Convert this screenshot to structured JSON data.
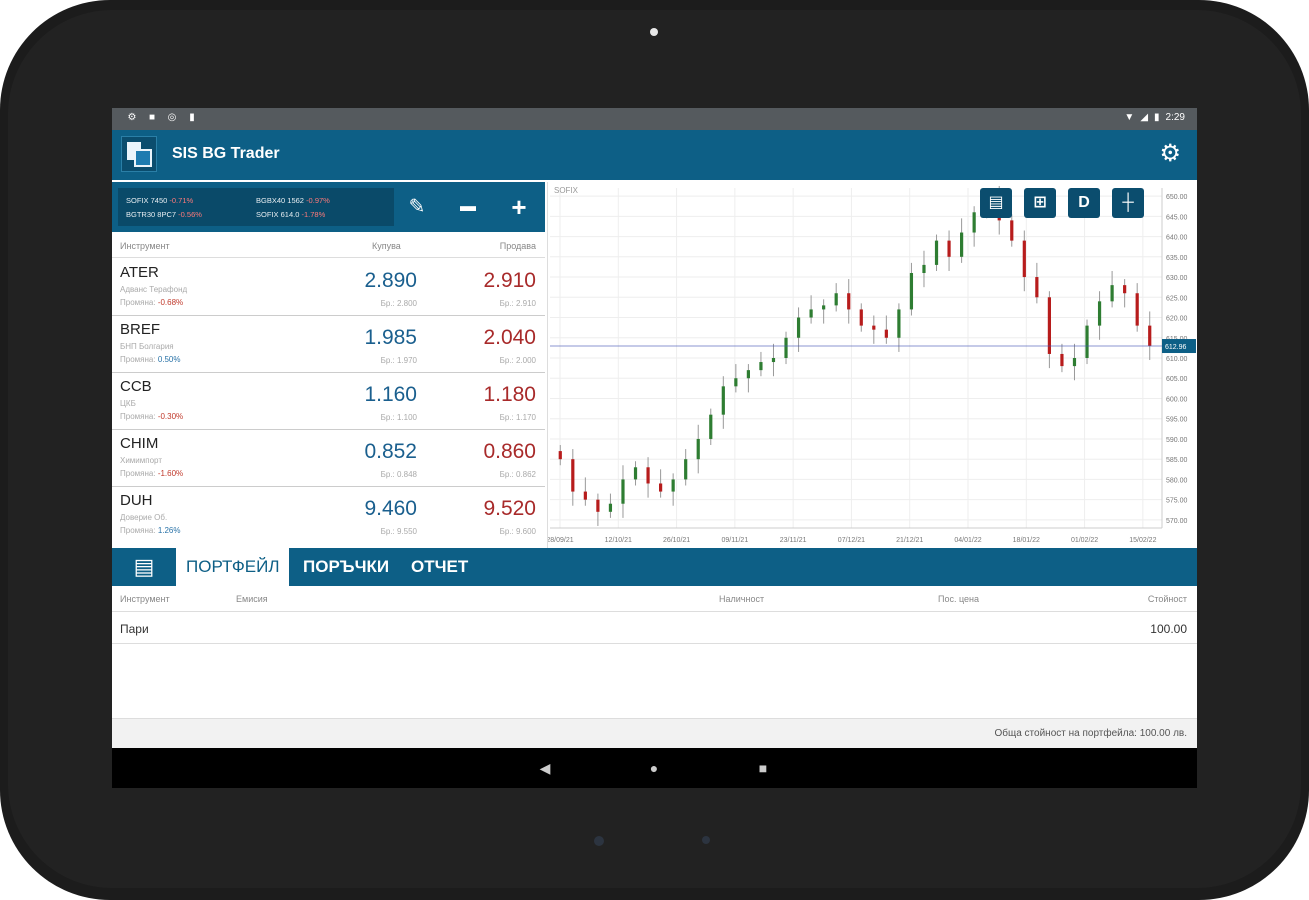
{
  "app": {
    "title": "SIS BG Trader"
  },
  "status": {
    "time": "2:29"
  },
  "ticker": [
    {
      "symbol": "SOFIX",
      "value": "7450",
      "change": "-0.71%"
    },
    {
      "symbol": "BGBX40",
      "value": "1562",
      "change": "-0.97%"
    },
    {
      "symbol": "BGTR30",
      "value": "8PC7",
      "change": "-0.56%"
    },
    {
      "symbol": "SOFIX",
      "value": "614.0",
      "change": "-1.78%"
    }
  ],
  "list": {
    "headers": {
      "instrument": "Инструмент",
      "buy": "Купува",
      "sell": "Продава"
    },
    "rows": [
      {
        "symbol": "ATER",
        "name": "Адванс Терафонд",
        "change_label": "Промяна:",
        "change": "-0.68%",
        "buy": "2.890",
        "sell": "2.910",
        "vol_buy": "Бр.: 2.800",
        "vol_sell": "Бр.: 2.910"
      },
      {
        "symbol": "BREF",
        "name": "БНП Болгария",
        "change_label": "Промяна:",
        "change": "0.50%",
        "buy": "1.985",
        "sell": "2.040",
        "vol_buy": "Бр.: 1.970",
        "vol_sell": "Бр.: 2.000"
      },
      {
        "symbol": "CCB",
        "name": "ЦКБ",
        "change_label": "Промяна:",
        "change": "-0.30%",
        "buy": "1.160",
        "sell": "1.180",
        "vol_buy": "Бр.: 1.100",
        "vol_sell": "Бр.: 1.170"
      },
      {
        "symbol": "CHIM",
        "name": "Химимпорт",
        "change_label": "Промяна:",
        "change": "-1.60%",
        "buy": "0.852",
        "sell": "0.860",
        "vol_buy": "Бр.: 0.848",
        "vol_sell": "Бр.: 0.862"
      },
      {
        "symbol": "DUH",
        "name": "Доверие Об.",
        "change_label": "Промяна:",
        "change": "1.26%",
        "buy": "9.460",
        "sell": "9.520",
        "vol_buy": "Бр.: 9.550",
        "vol_sell": "Бр.: 9.600"
      }
    ]
  },
  "chart": {
    "symbol": "SOFIX",
    "buttons": {
      "d": "D"
    },
    "y_ticks": [
      "650.00",
      "645.00",
      "640.00",
      "635.00",
      "630.00",
      "625.00",
      "620.00",
      "615.00",
      "610.00",
      "605.00",
      "600.00",
      "595.00",
      "590.00",
      "585.00",
      "580.00",
      "575.00",
      "570.00"
    ],
    "current_price": "612.96",
    "x_ticks": [
      "28/09/21",
      "12/10/21",
      "26/10/21",
      "09/11/21",
      "23/11/21",
      "07/12/21",
      "21/12/21",
      "04/01/22",
      "18/01/22",
      "01/02/22",
      "15/02/22"
    ],
    "colors": {
      "up": "#2e7d32",
      "down": "#b71c1c",
      "price_line": "#3f51b5"
    }
  },
  "chart_data": {
    "type": "candlestick",
    "ylim": [
      568,
      652
    ],
    "x": [
      "28/09/21",
      "12/10/21",
      "26/10/21",
      "09/11/21",
      "23/11/21",
      "07/12/21",
      "21/12/21",
      "04/01/22",
      "18/01/22",
      "01/02/22",
      "15/02/22"
    ],
    "close_series": [
      585,
      577,
      575,
      572,
      574,
      580,
      583,
      579,
      577,
      580,
      585,
      590,
      596,
      603,
      605,
      607,
      609,
      610,
      615,
      620,
      622,
      623,
      626,
      622,
      618,
      617,
      615,
      622,
      631,
      633,
      639,
      635,
      641,
      646,
      649,
      644,
      639,
      630,
      625,
      611,
      608,
      610,
      618,
      624,
      628,
      626,
      618,
      613
    ],
    "current_price": 612.96
  },
  "tabs": {
    "portfolio": "ПОРТФЕЙЛ",
    "orders": "ПОРЪЧКИ",
    "report": "ОТЧЕТ"
  },
  "portfolio": {
    "headers": {
      "instrument": "Инструмент",
      "issue": "Емисия",
      "quantity": "Наличност",
      "price": "Пос. цена",
      "value": "Стойност"
    },
    "rows": [
      {
        "instrument": "Пари",
        "value": "100.00"
      }
    ],
    "total": "Обща стойност на портфейла: 100.00 лв."
  }
}
